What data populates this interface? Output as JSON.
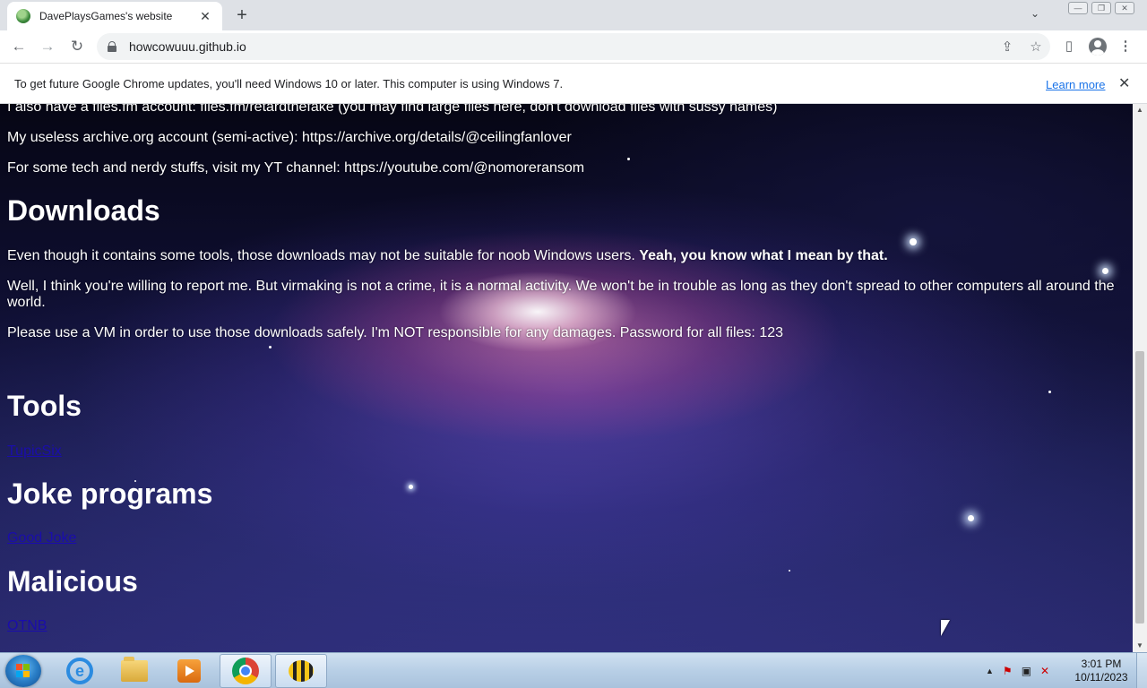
{
  "browser": {
    "tab": {
      "title": "DavePlaysGames's website",
      "close": "✕"
    },
    "new_tab": "+",
    "tab_search": "⌄",
    "window_controls": {
      "minimize": "—",
      "restore": "❐",
      "close": "✕"
    },
    "nav": {
      "back": "←",
      "forward": "→",
      "reload": "↻"
    },
    "address": "howcowuuu.github.io",
    "omnibox_icons": {
      "share": "⇪",
      "bookmark": "☆"
    },
    "side_panel": "▯"
  },
  "infobar": {
    "message": "To get future Google Chrome updates, you'll need Windows 10 or later. This computer is using Windows 7.",
    "learn_more": "Learn more",
    "close": "✕"
  },
  "page": {
    "line_files": "I also have a files.fm account: files.fm/retardthefake (you may find large files here, don't download files with sussy names)",
    "line_archive": "My useless archive.org account (semi-active): https://archive.org/details/@ceilingfanlover",
    "line_youtube": "For some tech and nerdy stuffs, visit my YT channel: https://youtube.com/@nomoreransom",
    "downloads_heading": "Downloads",
    "downloads_p1": "Even though it contains some tools, those downloads may not be suitable for noob Windows users.",
    "downloads_p1_bold": "Yeah, you know what I mean by that.",
    "downloads_p2": "Well, I think you're willing to report me. But virmaking is not a crime, it is a normal activity. We won't be in trouble as long as they don't spread to other computers all around the world.",
    "downloads_p3": "Please use a VM in order to use those downloads safely. I'm NOT responsible for any damages. Password for all files: 123",
    "tools_heading": "Tools",
    "tools_link": "TupicSix",
    "joke_heading": "Joke programs",
    "joke_link": "Good Joke",
    "malicious_heading": "Malicious",
    "malicious_link": "OTNB"
  },
  "scrollbar": {
    "up": "▲",
    "down": "▼"
  },
  "taskbar": {
    "tray_up": "▲",
    "clock_time": "3:01 PM",
    "clock_date": "10/11/2023"
  }
}
